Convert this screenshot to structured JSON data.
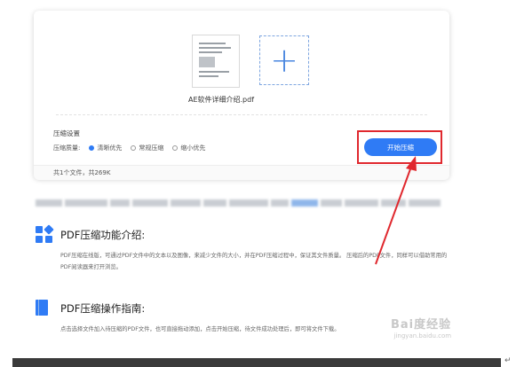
{
  "upload": {
    "file_name": "AE软件详细介绍.pdf",
    "add_icon": "plus-icon"
  },
  "settings": {
    "title": "压缩设置",
    "quality_label": "压缩质量:",
    "options": [
      "清晰优先",
      "常规压缩",
      "缩小优先"
    ],
    "selected_option": "清晰优先",
    "start_button": "开始压缩",
    "summary": "共1个文件，共269K"
  },
  "intro": {
    "title": "PDF压缩功能介绍:",
    "text": "PDF压缩在线版，可通过PDF文件中的文本以及图像，来减少文件的大小，并在PDF压缩过程中，保证其文件质量。 压缩后的PDF文件，同样可以借助常用的PDF阅读器来打开浏览。"
  },
  "guide": {
    "title": "PDF压缩操作指南:",
    "text": "点击选择文件加入待压缩的PDF文件，也可直接拖动添加，点击开始压缩，待文件成功处理后，即可将文件下载。"
  },
  "watermark": {
    "brand": "Bai度经验",
    "sub": "jingyan.baidu.com"
  },
  "doc_mark": "↵",
  "colors": {
    "accent": "#2f7bf5",
    "highlight": "#e0282e"
  }
}
